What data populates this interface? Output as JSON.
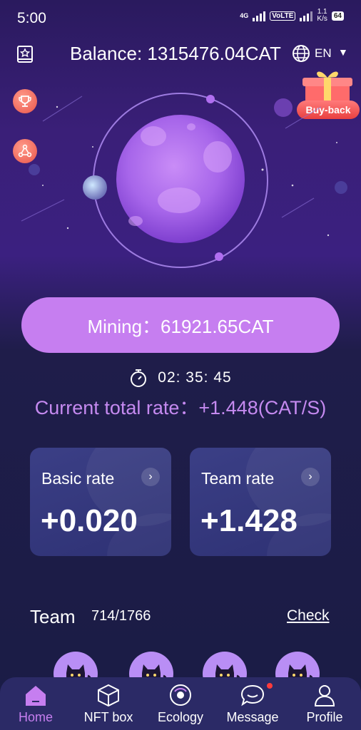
{
  "status": {
    "time": "5:00",
    "network": "4G",
    "volte": "VoLTE",
    "speed_value": "1.1",
    "speed_unit": "K/s",
    "battery": "64"
  },
  "header": {
    "balance": "Balance: 1315476.04CAT",
    "language": "EN"
  },
  "buyback": {
    "label": "Buy-back"
  },
  "mining": {
    "label": "Mining：61921.65CAT"
  },
  "timer": {
    "value": "02: 35: 45"
  },
  "total_rate": {
    "label": "Current total rate：+1.448(CAT/S)"
  },
  "cards": [
    {
      "title": "Basic rate",
      "value": "+0.020"
    },
    {
      "title": "Team rate",
      "value": "+1.428"
    }
  ],
  "team": {
    "title": "Team",
    "count": "714/1766",
    "check_label": "Check"
  },
  "tabs": [
    {
      "label": "Home",
      "icon": "home-icon",
      "active": true
    },
    {
      "label": "NFT box",
      "icon": "box-icon"
    },
    {
      "label": "Ecology",
      "icon": "ecology-icon"
    },
    {
      "label": "Message",
      "icon": "message-icon"
    },
    {
      "label": "Profile",
      "icon": "profile-icon"
    }
  ],
  "colors": {
    "accent": "#c67ef0",
    "rate_text": "#c58af0",
    "tabbar": "#2b2a66",
    "card": "#2e3174"
  }
}
